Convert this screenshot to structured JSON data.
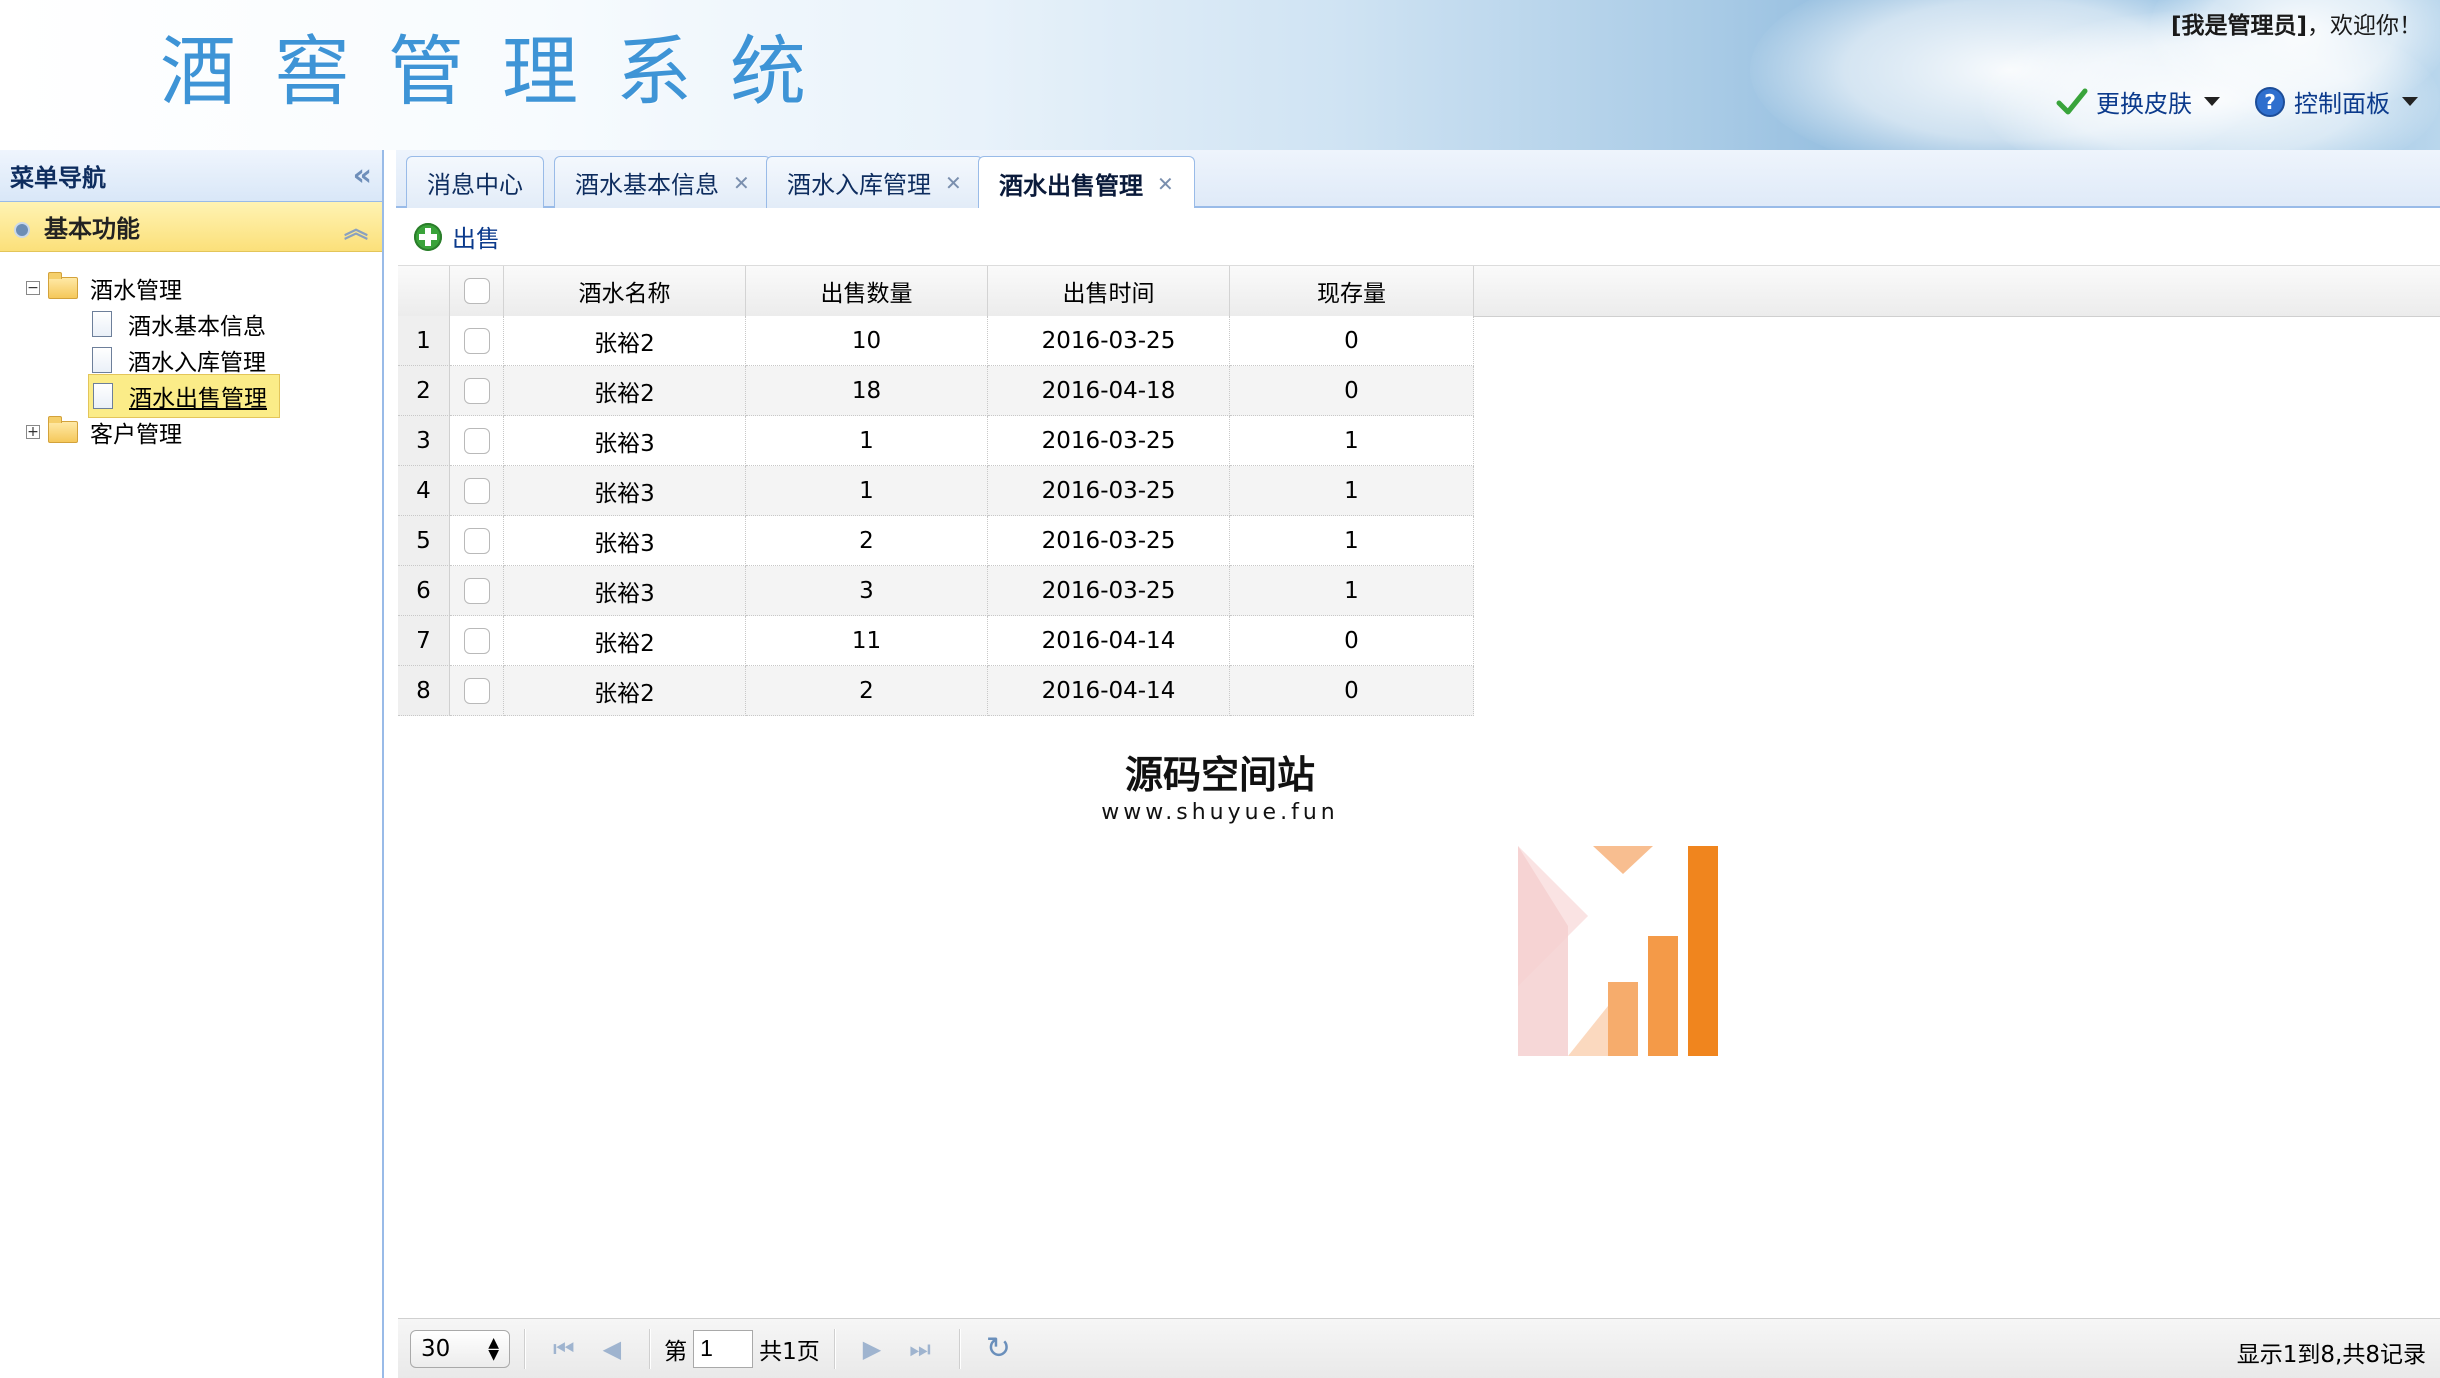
{
  "header": {
    "title": "酒窖管理系统",
    "welcome_user": "[我是管理员]",
    "welcome_text": "，欢迎你！",
    "change_skin_label": "更换皮肤",
    "control_panel_label": "控制面板"
  },
  "west": {
    "title": "菜单导航",
    "section_title": "基本功能",
    "tree": [
      {
        "label": "酒水管理",
        "expanded": true,
        "children": [
          {
            "label": "酒水基本信息"
          },
          {
            "label": "酒水入库管理"
          },
          {
            "label": "酒水出售管理",
            "selected": true
          }
        ]
      },
      {
        "label": "客户管理",
        "expanded": false
      }
    ]
  },
  "tabs": [
    {
      "label": "消息中心",
      "closable": false
    },
    {
      "label": "酒水基本信息",
      "closable": true
    },
    {
      "label": "酒水入库管理",
      "closable": true
    },
    {
      "label": "酒水出售管理",
      "closable": true,
      "active": true
    }
  ],
  "toolbar": {
    "sell_label": "出售"
  },
  "grid": {
    "columns": [
      "酒水名称",
      "出售数量",
      "出售时间",
      "现存量"
    ],
    "rows": [
      {
        "num": "1",
        "name": "张裕2",
        "qty": "10",
        "time": "2016-03-25",
        "stock": "0"
      },
      {
        "num": "2",
        "name": "张裕2",
        "qty": "18",
        "time": "2016-04-18",
        "stock": "0"
      },
      {
        "num": "3",
        "name": "张裕3",
        "qty": "1",
        "time": "2016-03-25",
        "stock": "1"
      },
      {
        "num": "4",
        "name": "张裕3",
        "qty": "1",
        "time": "2016-03-25",
        "stock": "1"
      },
      {
        "num": "5",
        "name": "张裕3",
        "qty": "2",
        "time": "2016-03-25",
        "stock": "1"
      },
      {
        "num": "6",
        "name": "张裕3",
        "qty": "3",
        "time": "2016-03-25",
        "stock": "1"
      },
      {
        "num": "7",
        "name": "张裕2",
        "qty": "11",
        "time": "2016-04-14",
        "stock": "0"
      },
      {
        "num": "8",
        "name": "张裕2",
        "qty": "2",
        "time": "2016-04-14",
        "stock": "0"
      }
    ]
  },
  "watermark": {
    "text": "源码空间站",
    "url": "www.shuyue.fun"
  },
  "pager": {
    "page_size": "30",
    "page_prefix": "第",
    "current_page": "1",
    "total_pages_text": "共1页",
    "info": "显示1到8,共8记录"
  },
  "colors": {
    "accent": "#0b3a8c",
    "border": "#99bbe8",
    "selected": "#fbec88",
    "title": "#3e94d6"
  }
}
